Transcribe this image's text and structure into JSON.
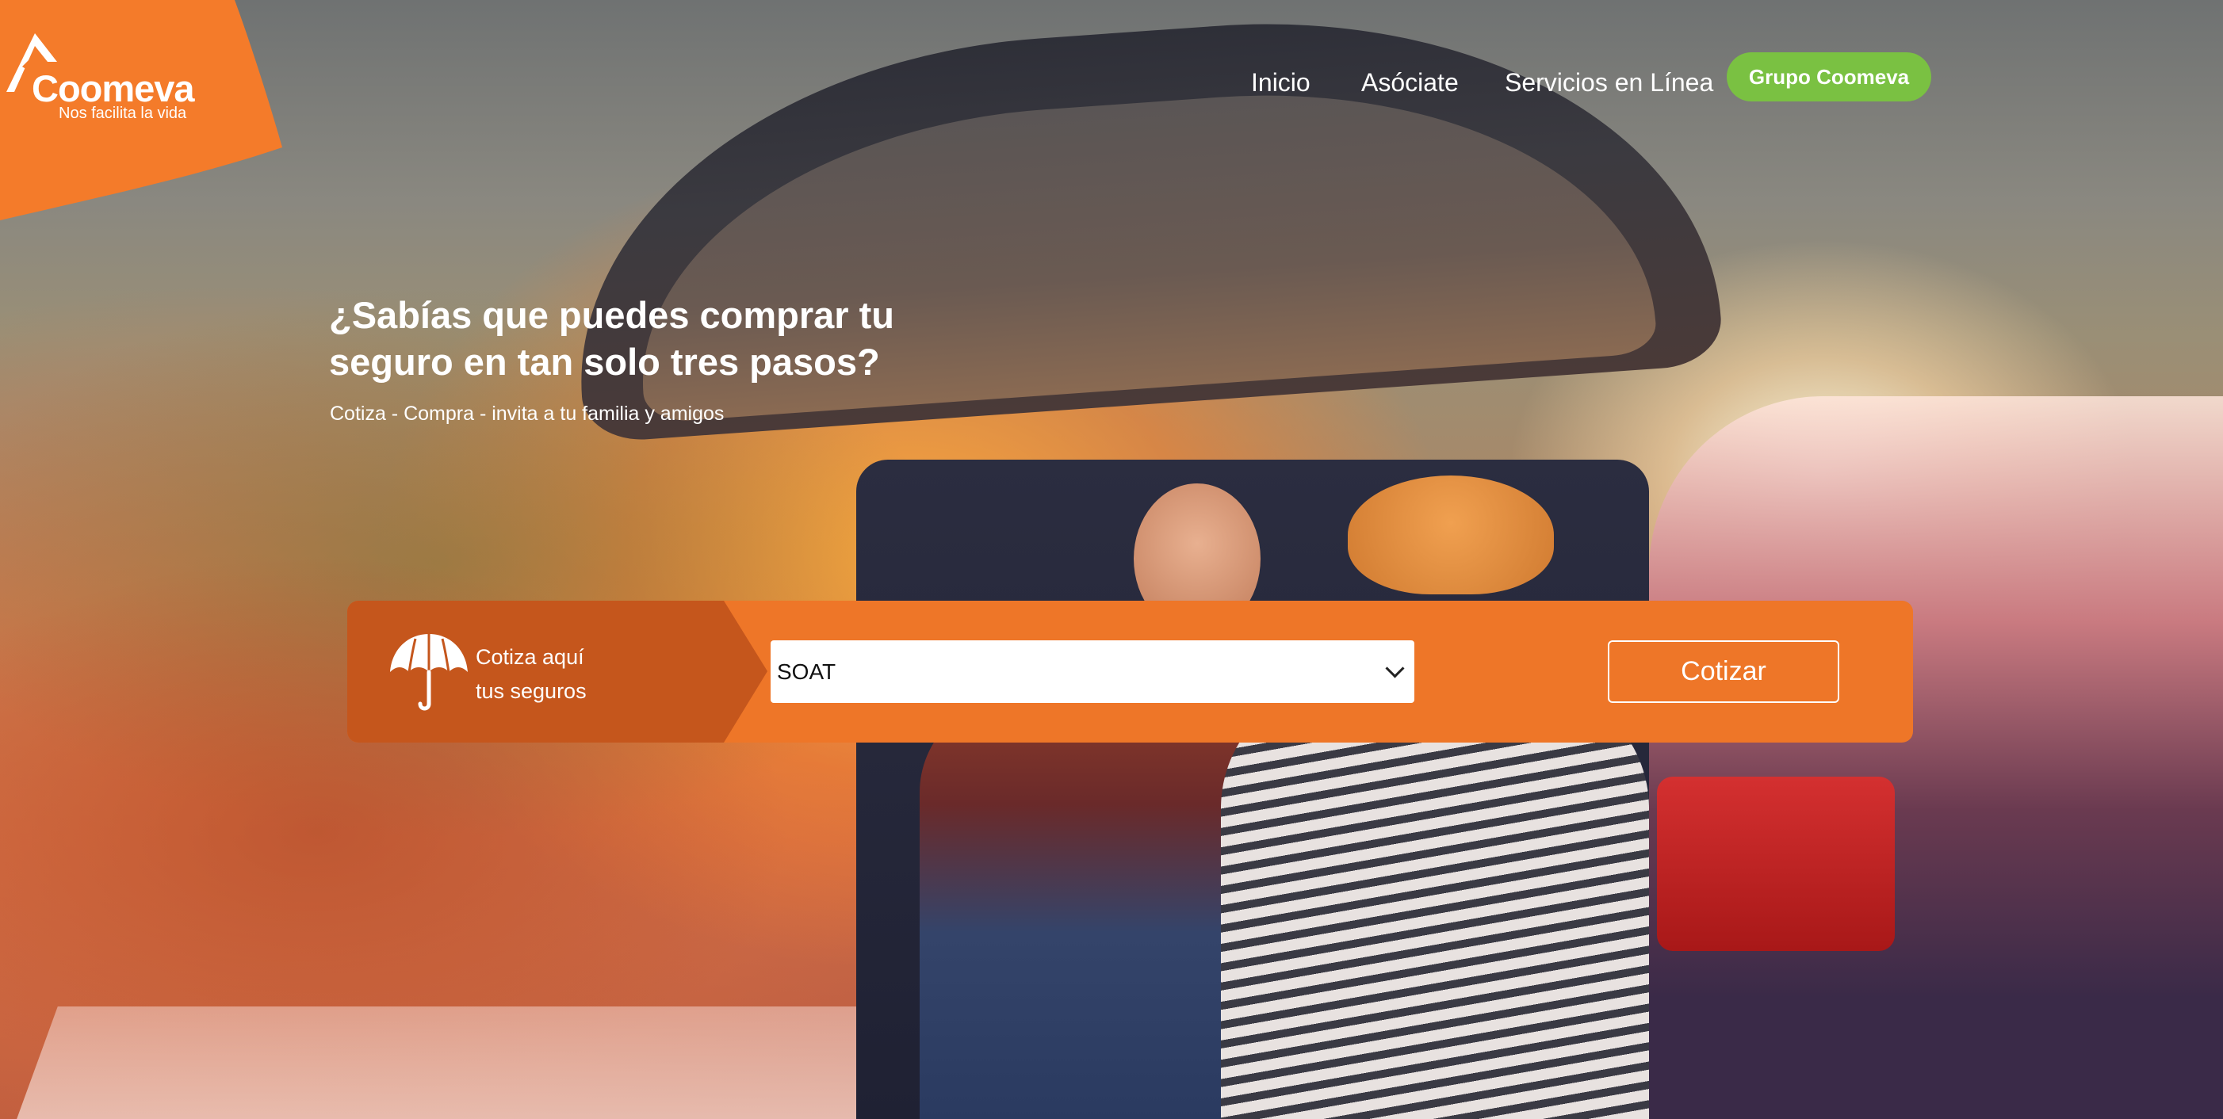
{
  "brand": {
    "name": "Coomeva",
    "tagline": "Nos facilita la vida",
    "color": "#f47b2a"
  },
  "nav": {
    "items": [
      {
        "label": "Inicio"
      },
      {
        "label": "Asóciate"
      },
      {
        "label": "Servicios en Línea"
      }
    ],
    "group_button": "Grupo Coomeva",
    "group_button_color": "#7ac142"
  },
  "hero": {
    "headline": "¿Sabías que puedes comprar tu seguro en tan solo tres pasos?",
    "subheadline": "Cotiza - Compra - invita a tu familia y amigos"
  },
  "quote": {
    "icon": "umbrella-icon",
    "label_line1": "Cotiza aquí",
    "label_line2": "tus seguros",
    "selected_option": "SOAT",
    "button_label": "Cotizar",
    "bar_color": "#ee7628",
    "label_panel_color": "#c5561c"
  }
}
